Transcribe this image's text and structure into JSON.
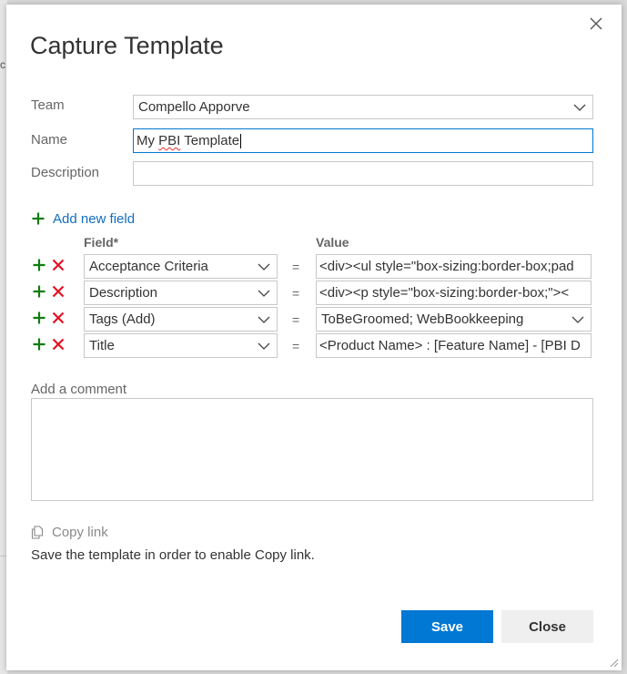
{
  "dialog": {
    "title": "Capture Template",
    "close_icon": "close-icon"
  },
  "backdrop": {
    "fragment": "c"
  },
  "form": {
    "team_label": "Team",
    "team_value": "Compello Apporve",
    "name_label": "Name",
    "name_value_prefix": "My ",
    "name_value_misspelled": "PBI",
    "name_value_suffix": " Template",
    "description_label": "Description",
    "description_value": ""
  },
  "fields": {
    "add_label": "Add new field",
    "field_header": "Field*",
    "value_header": "Value",
    "equals": "=",
    "rows": [
      {
        "field": "Acceptance Criteria",
        "value": "<div><ul style=\"box-sizing:border-box;pad",
        "value_is_dropdown": false
      },
      {
        "field": "Description",
        "value": "<div><p style=\"box-sizing:border-box;\"><",
        "value_is_dropdown": false
      },
      {
        "field": "Tags (Add)",
        "value": "ToBeGroomed; WebBookkeeping",
        "value_is_dropdown": true
      },
      {
        "field": "Title",
        "value": "<Product Name> : [Feature Name] - [PBI D",
        "value_is_dropdown": false
      }
    ]
  },
  "comment": {
    "label": "Add a comment",
    "value": ""
  },
  "copy_link": {
    "label": "Copy link",
    "note": "Save the template in order to enable Copy link."
  },
  "buttons": {
    "save": "Save",
    "close": "Close"
  },
  "colors": {
    "accent": "#0078d4",
    "link": "#106ebe",
    "add_green": "#107c10",
    "remove_red": "#e81123"
  }
}
